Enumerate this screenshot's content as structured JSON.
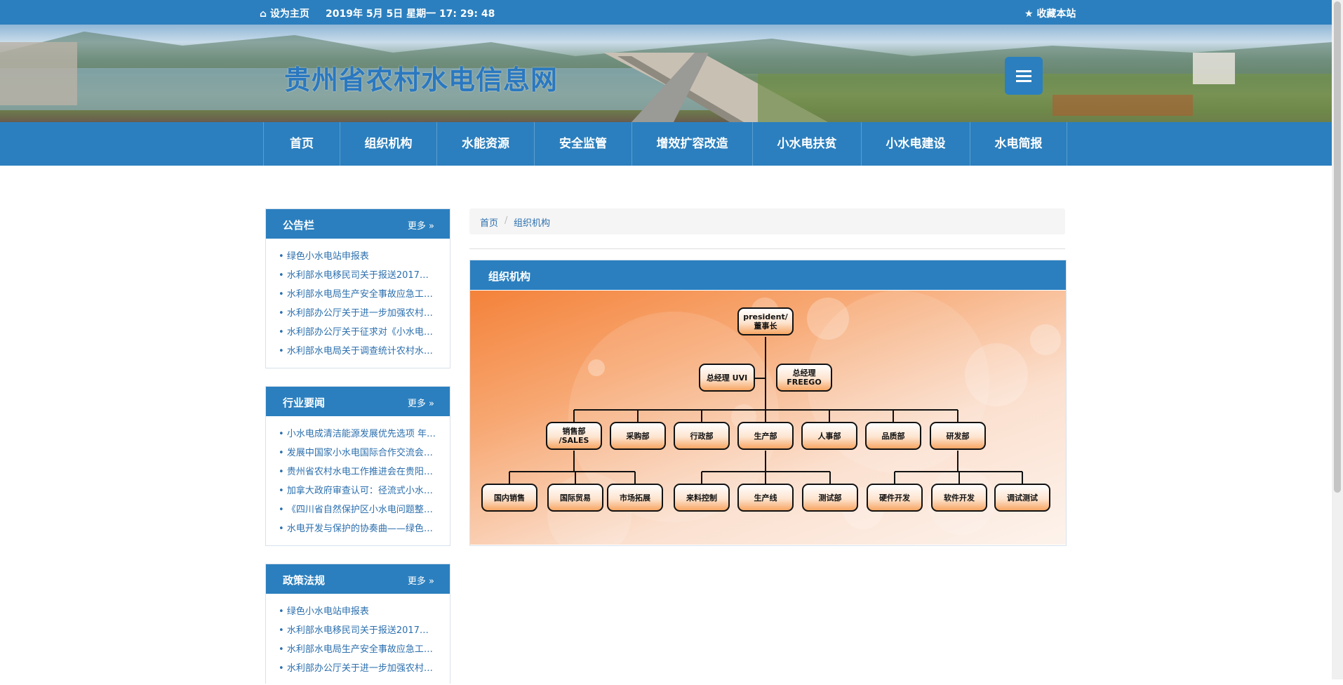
{
  "topbar": {
    "home": "设为主页",
    "date": "2019年 5月 5日 星期一 17: 29: 48",
    "favorite": "收藏本站"
  },
  "header": {
    "site_title": "贵州省农村水电信息网"
  },
  "nav": {
    "items": [
      "首页",
      "组织机构",
      "水能资源",
      "安全监管",
      "增效扩容改造",
      "小水电扶贫",
      "小水电建设",
      "水电简报"
    ]
  },
  "sidebar": {
    "panels": [
      {
        "title": "公告栏",
        "more": "更多",
        "items": [
          "绿色小水电站申报表",
          "水利部水电移民司关于报送2017年…",
          "水利部水电局生产安全事故应急工…",
          "水利部办公厅关于进一步加强农村…",
          "水利部办公厅关于征求对《小水电…",
          "水利部水电局关于调查统计农村水…"
        ]
      },
      {
        "title": "行业要闻",
        "more": "更多",
        "items": [
          "小水电成清洁能源发展优先选项 年…",
          "发展中国家小水电国际合作交流会…",
          "贵州省农村水电工作推进会在贵阳…",
          "加拿大政府审查认可：径流式小水…",
          "《四川省自然保护区小水电问题整…",
          "水电开发与保护的协奏曲——绿色…"
        ]
      },
      {
        "title": "政策法规",
        "more": "更多",
        "items": [
          "绿色小水电站申报表",
          "水利部水电移民司关于报送2017年…",
          "水利部水电局生产安全事故应急工…",
          "水利部办公厅关于进一步加强农村…"
        ]
      }
    ]
  },
  "breadcrumb": {
    "home": "首页",
    "sep": "/",
    "current": "组织机构"
  },
  "main": {
    "title": "组织机构"
  },
  "org": {
    "president": "president/ 董事长",
    "gm1": "总经理 UVI",
    "gm2": "总经理 FREEGO",
    "depts": [
      "销售部 /SALES",
      "采购部",
      "行政部",
      "生产部",
      "人事部",
      "品质部",
      "研发部"
    ],
    "subs": [
      "国内销售",
      "国际贸易",
      "市场拓展",
      "来料控制",
      "生产线",
      "测试部",
      "硬件开发",
      "软件开发",
      "调试测试"
    ]
  },
  "colors": {
    "brand": "#2b7fbe",
    "link": "#2b6fae"
  }
}
